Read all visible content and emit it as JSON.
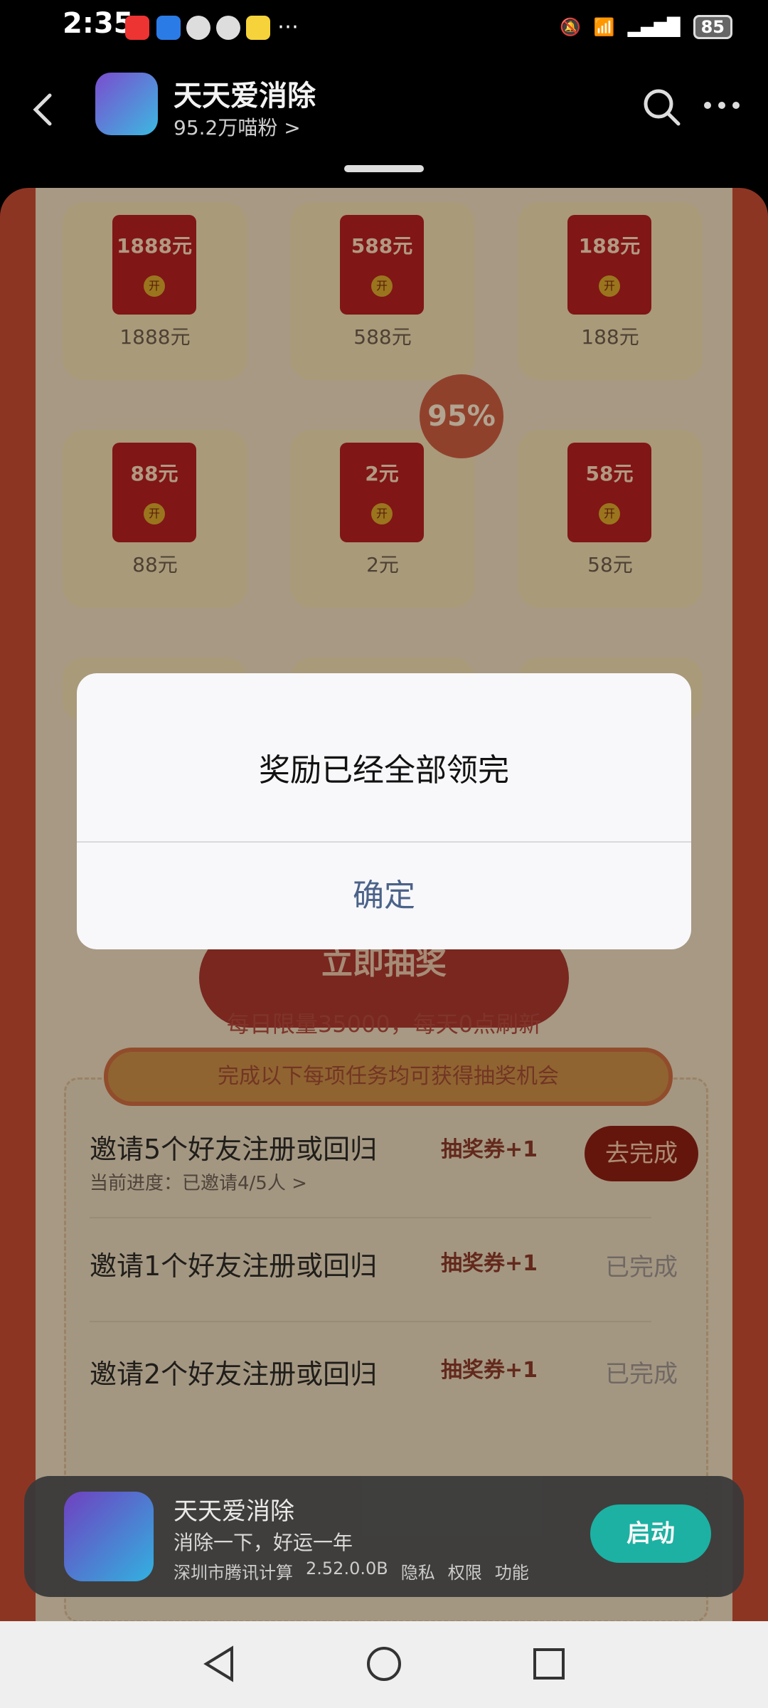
{
  "status_bar": {
    "time": "2:35",
    "battery": "85"
  },
  "header": {
    "title": "天天爱消除",
    "subtitle": "95.2万喵粉 >"
  },
  "rewards": [
    {
      "amount": "1888元",
      "label": "1888元"
    },
    {
      "amount": "588元",
      "label": "588元"
    },
    {
      "amount": "188元",
      "label": "188元"
    },
    {
      "amount": "88元",
      "label": "88元"
    },
    {
      "amount": "2元",
      "label": "2元"
    },
    {
      "amount": "58元",
      "label": "58元"
    }
  ],
  "badge": "95%",
  "envelope_open": "开",
  "draw_button": "立即抽奖",
  "limit_text": "每日限量35000，每天0点刷新",
  "task_banner": "完成以下每项任务均可获得抽奖机会",
  "tasks": [
    {
      "title": "邀请5个好友注册或回归",
      "progress": "当前进度：已邀请4/5人 >",
      "reward": "抽奖券+1",
      "status": "去完成"
    },
    {
      "title": "邀请1个好友注册或回归",
      "progress": "",
      "reward": "抽奖券+1",
      "status": "已完成"
    },
    {
      "title": "邀请2个好友注册或回归",
      "progress": "",
      "reward": "抽奖券+1",
      "status": "已完成"
    }
  ],
  "dialog": {
    "message": "奖励已经全部领完",
    "confirm": "确定"
  },
  "app_card": {
    "name": "天天爱消除",
    "slogan": "消除一下，好运一年",
    "developer": "深圳市腾讯计算",
    "version": "2.52.0.0B",
    "privacy": "隐私",
    "permissions": "权限",
    "features": "功能",
    "launch": "启动"
  }
}
